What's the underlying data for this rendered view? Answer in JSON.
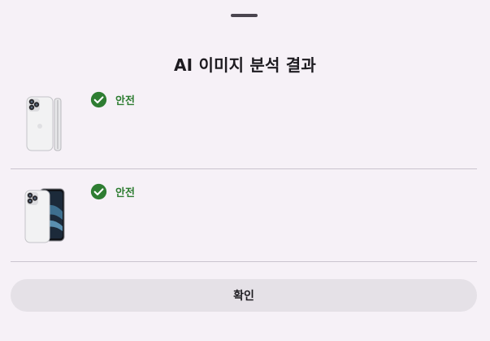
{
  "sheet": {
    "title": "AI 이미지 분석 결과"
  },
  "results": [
    {
      "thumbnail": "phone-back-white-image",
      "status_icon": "check-circle-icon",
      "status_label": "안전",
      "status_color": "#2e7d32"
    },
    {
      "thumbnail": "phone-front-back-image",
      "status_icon": "check-circle-icon",
      "status_label": "안전",
      "status_color": "#2e7d32"
    }
  ],
  "actions": {
    "confirm_label": "확인"
  },
  "colors": {
    "background": "#f6f1f7",
    "button_background": "#e5e1e7",
    "divider": "#cac4cf",
    "success": "#2e7d32"
  }
}
